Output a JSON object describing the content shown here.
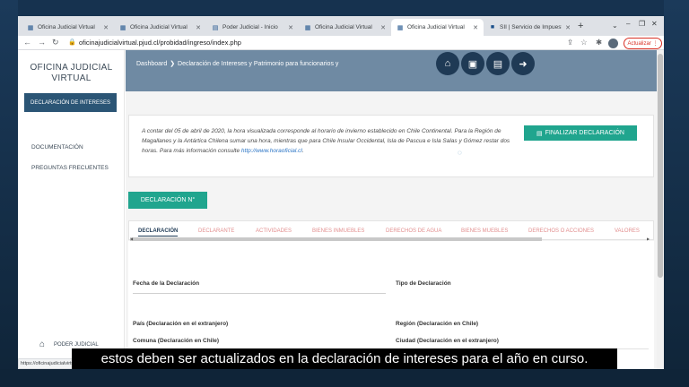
{
  "browser": {
    "tabs": [
      {
        "label": "Oficina Judicial Virtual",
        "icon": "court-icon"
      },
      {
        "label": "Oficina Judicial Virtual",
        "icon": "court-icon"
      },
      {
        "label": "Poder Judicial - Inicio",
        "icon": "page-icon"
      },
      {
        "label": "Oficina Judicial Virtual",
        "icon": "court-icon"
      },
      {
        "label": "Oficina Judicial Virtual",
        "icon": "court-icon",
        "active": true
      },
      {
        "label": "SII | Servicio de Impuestos In",
        "icon": "sii-icon"
      }
    ],
    "url": "oficinajudicialvirtual.pjud.cl/probidad/ingreso/index.php",
    "update_label": "Actualizar",
    "status_url": "https://oficinajudicialvirtu"
  },
  "sidebar": {
    "brand_line1": "OFICINA JUDICIAL",
    "brand_line2": "VIRTUAL",
    "active_item": "DECLARACIÓN DE INTERESES",
    "items": [
      "DOCUMENTACIÓN",
      "PREGUNTAS FRECUENTES"
    ],
    "footer": "PODER JUDICIAL"
  },
  "header": {
    "crumb_home": "Dashboard",
    "crumb_current": "Declaración de Intereses y Patrimonio para funcionarios y"
  },
  "notice": {
    "text": "A contar del 05 de abril de 2020, la hora visualizada corresponde al horario de invierno establecido en Chile Continental. Para la Región de Magallanes y la Antártica Chilena sumar una hora, mientras que para Chile Insular Occidental, Isla de Pascua e Isla Salas y Gómez restar dos horas. Para más información consulte",
    "link": "http://www.horaoficial.cl",
    "link_suffix": ".",
    "finalize_label": "FINALIZAR DECLARACIÓN"
  },
  "declaration_button": "DECLARACIÓN N°",
  "tabs": [
    "DECLARACIÓN",
    "DECLARANTE",
    "ACTIVIDADES",
    "BIENES INMUEBLES",
    "DERECHOS DE AGUA",
    "BIENES MUEBLES",
    "DERECHOS O ACCIONES",
    "VALORES"
  ],
  "form": {
    "fecha": "Fecha de la Declaración",
    "tipo": "Tipo de Declaración",
    "pais": "País (Declaración en el extranjero)",
    "region": "Región (Declaración en Chile)",
    "comuna": "Comuna (Declaración en Chile)",
    "ciudad": "Ciudad (Declaración en el extranjero)"
  },
  "caption": "estos deben ser actualizados en la declaración de intereses para el año en curso."
}
